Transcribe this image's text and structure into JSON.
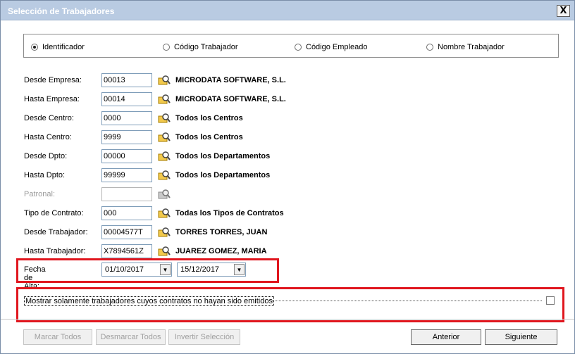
{
  "window": {
    "title": "Selección de Trabajadores",
    "close_label": "X"
  },
  "radio_options": [
    {
      "label": "Identificador",
      "checked": true
    },
    {
      "label": "Código Trabajador",
      "checked": false
    },
    {
      "label": "Código Empleado",
      "checked": false
    },
    {
      "label": "Nombre Trabajador",
      "checked": false
    }
  ],
  "fields": [
    {
      "label": "Desde Empresa:",
      "value": "00013",
      "desc": "MICRODATA SOFTWARE, S.L.",
      "enabled": true
    },
    {
      "label": "Hasta Empresa:",
      "value": "00014",
      "desc": "MICRODATA SOFTWARE, S.L.",
      "enabled": true
    },
    {
      "label": "Desde Centro:",
      "value": "0000",
      "desc": "Todos los Centros",
      "enabled": true
    },
    {
      "label": "Hasta Centro:",
      "value": "9999",
      "desc": "Todos los Centros",
      "enabled": true
    },
    {
      "label": "Desde Dpto:",
      "value": "00000",
      "desc": "Todos los Departamentos",
      "enabled": true
    },
    {
      "label": "Hasta Dpto:",
      "value": "99999",
      "desc": "Todos los Departamentos",
      "enabled": true
    },
    {
      "label": "Patronal:",
      "value": "",
      "desc": "",
      "enabled": false
    },
    {
      "label": "Tipo de Contrato:",
      "value": "000",
      "desc": "Todas los Tipos de Contratos",
      "enabled": true
    },
    {
      "label": "Desde Trabajador:",
      "value": "00004577T",
      "desc": "TORRES TORRES, JUAN",
      "enabled": true
    },
    {
      "label": "Hasta Trabajador:",
      "value": "X7894561Z",
      "desc": "JUAREZ GOMEZ, MARIA",
      "enabled": true
    }
  ],
  "fecha_alta": {
    "label": "Fecha de Alta:",
    "from": "01/10/2017",
    "to": "15/12/2017"
  },
  "checkbox": {
    "label": "Mostrar solamente trabajadores cuyos contratos no hayan sido emitidos",
    "checked": false
  },
  "buttons": {
    "marcar_todos": "Marcar Todos",
    "desmarcar_todos": "Desmarcar Todos",
    "invertir": "Invertir Selección",
    "anterior": "Anterior",
    "siguiente": "Siguiente"
  },
  "colors": {
    "highlight": "#e0161e",
    "titlebar": "#b9cbe2",
    "field_border": "#7f9db9"
  },
  "icons": {
    "lookup": "search-folder-icon",
    "dropdown": "chevron-down-icon"
  }
}
